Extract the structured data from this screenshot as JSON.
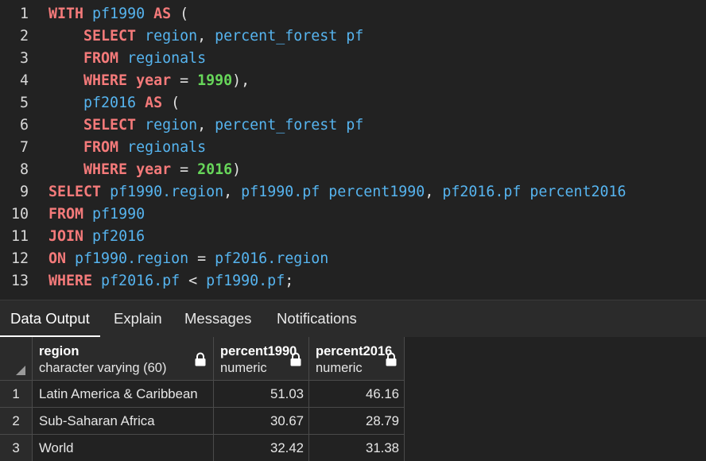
{
  "editor": {
    "lines": [
      {
        "n": "1",
        "tokens": [
          [
            "kw",
            "WITH"
          ],
          [
            "op",
            " "
          ],
          [
            "id",
            "pf1990"
          ],
          [
            "op",
            " "
          ],
          [
            "kw",
            "AS"
          ],
          [
            "op",
            " ("
          ]
        ]
      },
      {
        "n": "2",
        "tokens": [
          [
            "op",
            "    "
          ],
          [
            "kw",
            "SELECT"
          ],
          [
            "op",
            " "
          ],
          [
            "id",
            "region"
          ],
          [
            "op",
            ", "
          ],
          [
            "id",
            "percent_forest"
          ],
          [
            "op",
            " "
          ],
          [
            "id",
            "pf"
          ]
        ]
      },
      {
        "n": "3",
        "tokens": [
          [
            "op",
            "    "
          ],
          [
            "kw",
            "FROM"
          ],
          [
            "op",
            " "
          ],
          [
            "id",
            "regionals"
          ]
        ]
      },
      {
        "n": "4",
        "tokens": [
          [
            "op",
            "    "
          ],
          [
            "kw",
            "WHERE"
          ],
          [
            "op",
            " "
          ],
          [
            "kw",
            "year"
          ],
          [
            "op",
            " = "
          ],
          [
            "num",
            "1990"
          ],
          [
            "op",
            "),"
          ]
        ]
      },
      {
        "n": "5",
        "tokens": [
          [
            "op",
            "    "
          ],
          [
            "id",
            "pf2016"
          ],
          [
            "op",
            " "
          ],
          [
            "kw",
            "AS"
          ],
          [
            "op",
            " ("
          ]
        ]
      },
      {
        "n": "6",
        "tokens": [
          [
            "op",
            "    "
          ],
          [
            "kw",
            "SELECT"
          ],
          [
            "op",
            " "
          ],
          [
            "id",
            "region"
          ],
          [
            "op",
            ", "
          ],
          [
            "id",
            "percent_forest"
          ],
          [
            "op",
            " "
          ],
          [
            "id",
            "pf"
          ]
        ]
      },
      {
        "n": "7",
        "tokens": [
          [
            "op",
            "    "
          ],
          [
            "kw",
            "FROM"
          ],
          [
            "op",
            " "
          ],
          [
            "id",
            "regionals"
          ]
        ]
      },
      {
        "n": "8",
        "tokens": [
          [
            "op",
            "    "
          ],
          [
            "kw",
            "WHERE"
          ],
          [
            "op",
            " "
          ],
          [
            "kw",
            "year"
          ],
          [
            "op",
            " = "
          ],
          [
            "num",
            "2016"
          ],
          [
            "op",
            ")"
          ]
        ]
      },
      {
        "n": "9",
        "tokens": [
          [
            "kw",
            "SELECT"
          ],
          [
            "op",
            " "
          ],
          [
            "id",
            "pf1990.region"
          ],
          [
            "op",
            ", "
          ],
          [
            "id",
            "pf1990.pf"
          ],
          [
            "op",
            " "
          ],
          [
            "id",
            "percent1990"
          ],
          [
            "op",
            ", "
          ],
          [
            "id",
            "pf2016.pf"
          ],
          [
            "op",
            " "
          ],
          [
            "id",
            "percent2016"
          ]
        ]
      },
      {
        "n": "10",
        "tokens": [
          [
            "kw",
            "FROM"
          ],
          [
            "op",
            " "
          ],
          [
            "id",
            "pf1990"
          ]
        ]
      },
      {
        "n": "11",
        "tokens": [
          [
            "kw",
            "JOIN"
          ],
          [
            "op",
            " "
          ],
          [
            "id",
            "pf2016"
          ]
        ]
      },
      {
        "n": "12",
        "tokens": [
          [
            "kw",
            "ON"
          ],
          [
            "op",
            " "
          ],
          [
            "id",
            "pf1990.region"
          ],
          [
            "op",
            " = "
          ],
          [
            "id",
            "pf2016.region"
          ]
        ]
      },
      {
        "n": "13",
        "tokens": [
          [
            "kw",
            "WHERE"
          ],
          [
            "op",
            " "
          ],
          [
            "id",
            "pf2016.pf"
          ],
          [
            "op",
            " < "
          ],
          [
            "id",
            "pf1990.pf"
          ],
          [
            "op",
            ";"
          ]
        ]
      }
    ]
  },
  "tabs": [
    {
      "label": "Data Output",
      "active": true
    },
    {
      "label": "Explain",
      "active": false
    },
    {
      "label": "Messages",
      "active": false
    },
    {
      "label": "Notifications",
      "active": false
    }
  ],
  "grid": {
    "columns": [
      {
        "name": "region",
        "type": "character varying (60)",
        "icon": "lock-icon"
      },
      {
        "name": "percent1990",
        "type": "numeric",
        "icon": "lock-icon"
      },
      {
        "name": "percent2016",
        "type": "numeric",
        "icon": "lock-icon"
      }
    ],
    "rows": [
      {
        "n": "1",
        "cells": [
          "Latin America & Caribbean",
          "51.03",
          "46.16"
        ]
      },
      {
        "n": "2",
        "cells": [
          "Sub-Saharan Africa",
          "30.67",
          "28.79"
        ]
      },
      {
        "n": "3",
        "cells": [
          "World",
          "32.42",
          "31.38"
        ]
      }
    ]
  },
  "colors": {
    "background": "#222222",
    "keyword": "#f47a7a",
    "identifier": "#56b4ef",
    "number": "#67d65a",
    "grid_border": "#4a4a4a"
  }
}
